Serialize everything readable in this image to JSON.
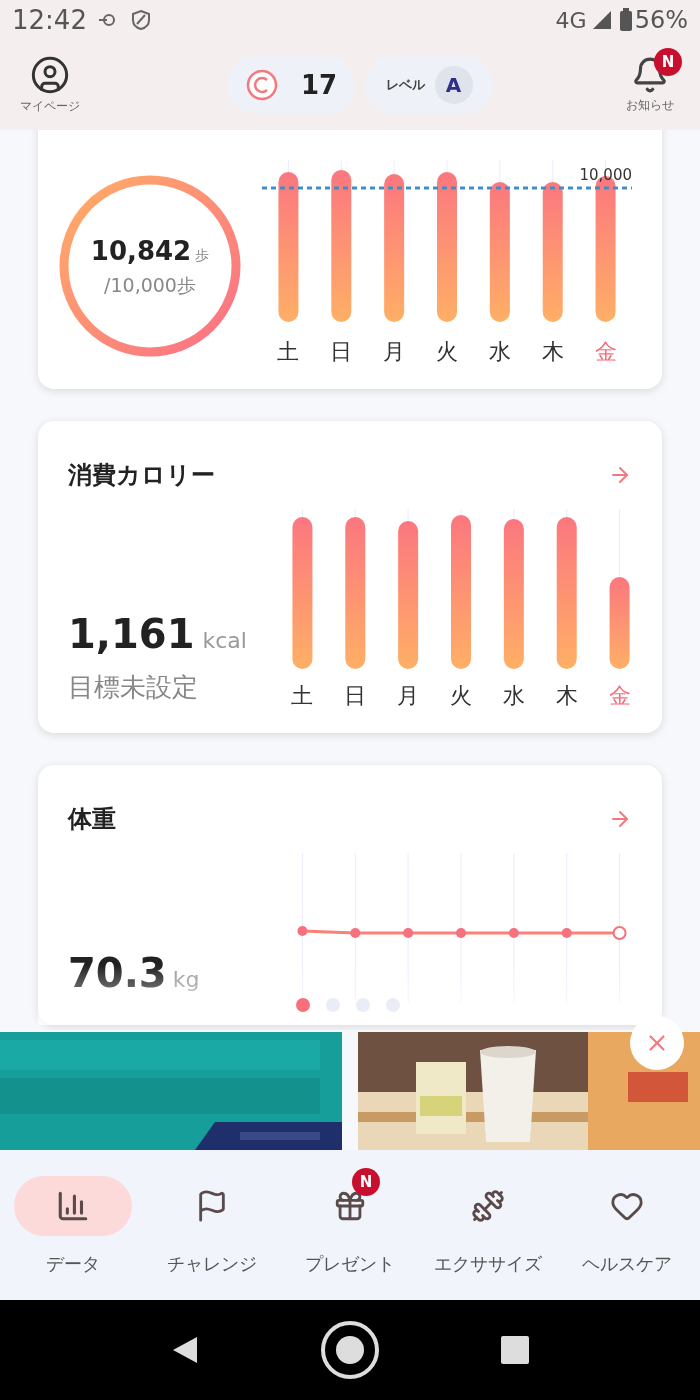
{
  "status_bar": {
    "time": "12:42",
    "network": "4G",
    "battery": "56%"
  },
  "header": {
    "mypage_label": "マイページ",
    "coins": "17",
    "level_label": "レベル",
    "level": "A",
    "notice_badge": "N",
    "notice_label": "お知らせ"
  },
  "steps_card": {
    "value": "10,842",
    "unit": "歩",
    "goal": "/10,000歩",
    "goal_line_label": "10,000",
    "days": [
      {
        "label": "土",
        "selected": false
      },
      {
        "label": "日",
        "selected": false
      },
      {
        "label": "月",
        "selected": false
      },
      {
        "label": "火",
        "selected": false
      },
      {
        "label": "水",
        "selected": false
      },
      {
        "label": "木",
        "selected": false
      },
      {
        "label": "金",
        "selected": true
      }
    ]
  },
  "calorie_card": {
    "title": "消費カロリー",
    "value": "1,161",
    "unit": "kcal",
    "note": "目標未設定",
    "days": [
      {
        "label": "土",
        "selected": false
      },
      {
        "label": "日",
        "selected": false
      },
      {
        "label": "月",
        "selected": false
      },
      {
        "label": "火",
        "selected": false
      },
      {
        "label": "水",
        "selected": false
      },
      {
        "label": "木",
        "selected": false
      },
      {
        "label": "金",
        "selected": true
      }
    ]
  },
  "weight_card": {
    "title": "体重",
    "value": "70.3",
    "unit": "kg"
  },
  "pager": [
    {
      "selected": true
    },
    {
      "selected": false
    },
    {
      "selected": false
    },
    {
      "selected": false
    }
  ],
  "bottom_nav": [
    {
      "label": "データ",
      "kind": "chart",
      "selected": true
    },
    {
      "label": "チャレンジ",
      "kind": "flag",
      "selected": false
    },
    {
      "label": "プレゼント",
      "kind": "gift",
      "selected": false,
      "badge": "N"
    },
    {
      "label": "エクササイズ",
      "kind": "dumbbell",
      "selected": false
    },
    {
      "label": "ヘルスケア",
      "kind": "heart",
      "selected": false
    }
  ]
}
